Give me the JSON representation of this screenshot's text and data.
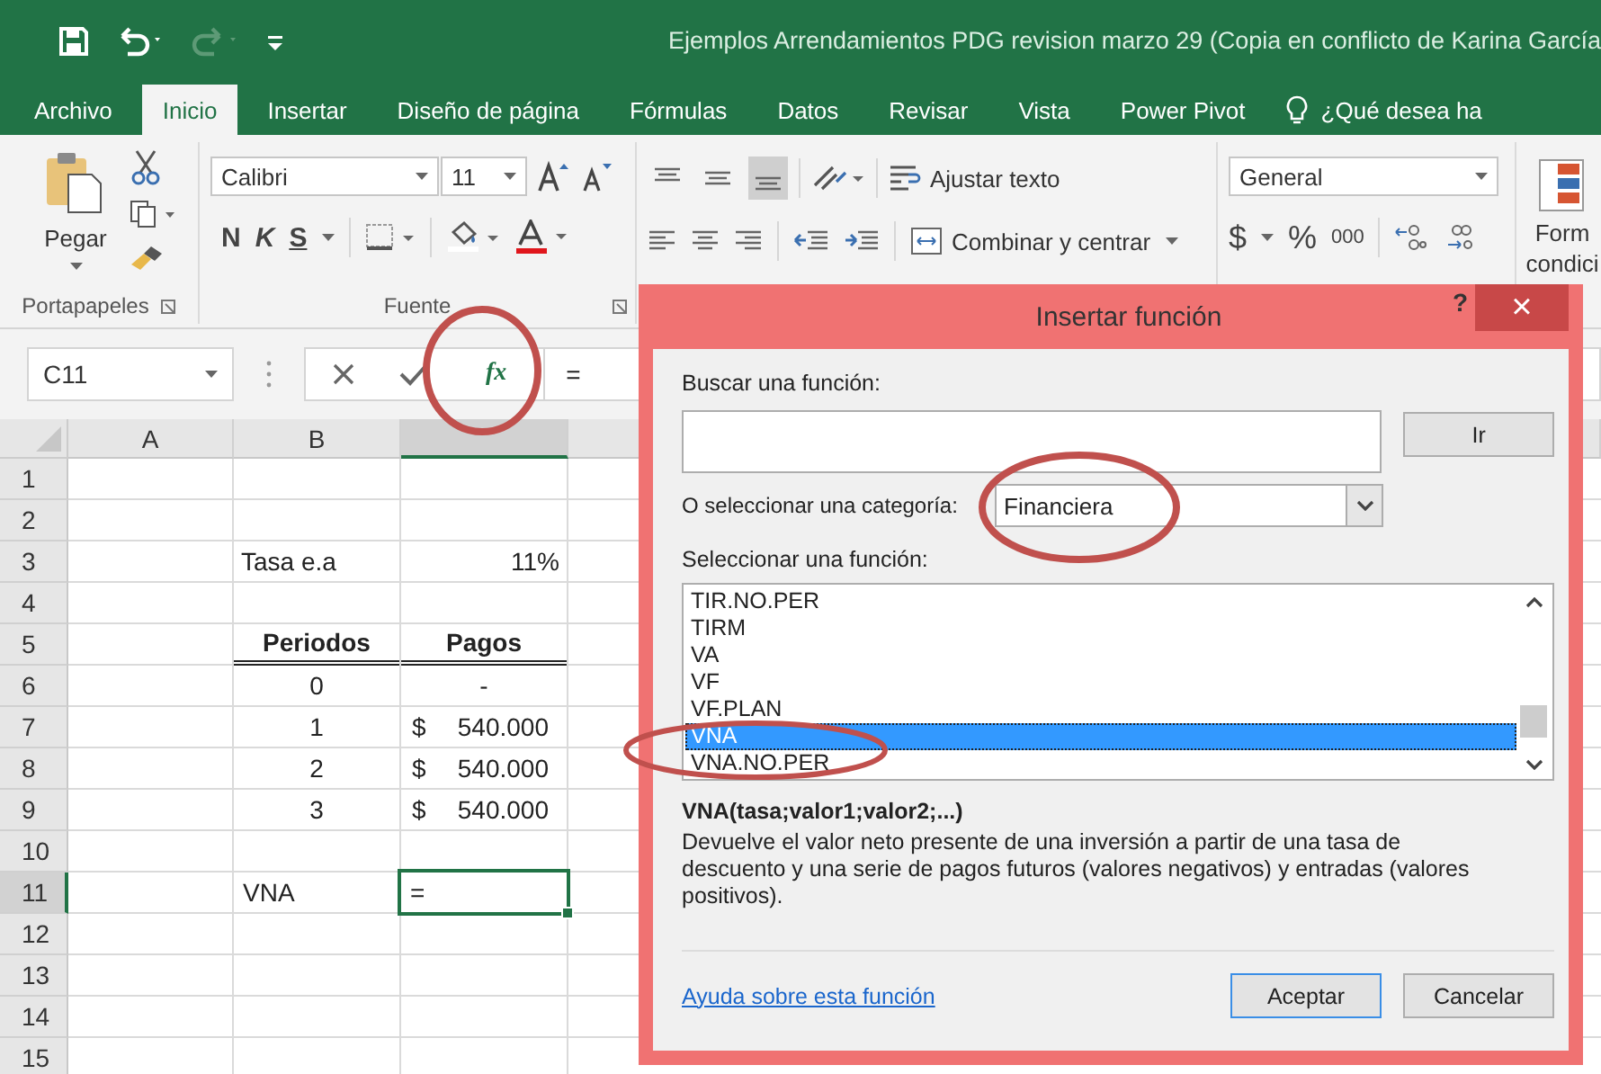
{
  "title_bar": {
    "quick_access": [
      {
        "kind": "save",
        "disabled": false
      },
      {
        "kind": "undo",
        "disabled": false
      },
      {
        "kind": "redo",
        "disabled": true
      },
      {
        "kind": "customize",
        "disabled": false
      }
    ],
    "title": "Ejemplos Arrendamientos PDG revision marzo 29 (Copia en conflicto de Karina García"
  },
  "tabs": [
    {
      "label": "Archivo",
      "selected": false
    },
    {
      "label": "Inicio",
      "selected": true
    },
    {
      "label": "Insertar",
      "selected": false
    },
    {
      "label": "Diseño de página",
      "selected": false
    },
    {
      "label": "Fórmulas",
      "selected": false
    },
    {
      "label": "Datos",
      "selected": false
    },
    {
      "label": "Revisar",
      "selected": false
    },
    {
      "label": "Vista",
      "selected": false
    },
    {
      "label": "Power Pivot",
      "selected": false
    }
  ],
  "tell_me": {
    "label": "¿Qué desea ha"
  },
  "ribbon": {
    "clipboard": {
      "paste": "Pegar",
      "label": "Portapapeles"
    },
    "font": {
      "name": "Calibri",
      "size": "11",
      "bold": "N",
      "italic": "K",
      "underline": "S",
      "label": "Fuente"
    },
    "alignment": {
      "vertical_align": [
        {
          "selected": false
        },
        {
          "selected": false
        },
        {
          "selected": true
        }
      ],
      "wrap": "Ajustar texto",
      "merge": "Combinar y centrar"
    },
    "number": {
      "format": "General",
      "currency": "$",
      "percent": "%",
      "thousands": "000"
    },
    "styles": {
      "conditional": [
        "Form",
        "condici"
      ]
    }
  },
  "formula_bar": {
    "name_box": "C11",
    "function_button": "fx",
    "formula": "="
  },
  "sheet": {
    "columns": [
      {
        "label": "A",
        "selected": false
      },
      {
        "label": "B",
        "selected": false
      },
      {
        "selected": true
      }
    ],
    "rows": [
      {
        "number": "1",
        "selected": false,
        "kind": "label"
      },
      {
        "number": "2",
        "selected": false,
        "kind": "label"
      },
      {
        "number": "3",
        "selected": false,
        "kind": "label",
        "b": "Tasa e.a",
        "c": "11%"
      },
      {
        "number": "4",
        "selected": false,
        "kind": "label"
      },
      {
        "number": "5",
        "selected": false,
        "kind": "header",
        "b": "Periodos",
        "c": "Pagos"
      },
      {
        "number": "6",
        "selected": false,
        "kind": "data",
        "b": "0",
        "c": "-"
      },
      {
        "number": "7",
        "selected": false,
        "kind": "data",
        "b": "1",
        "currency": "$",
        "c": "540.000"
      },
      {
        "number": "8",
        "selected": false,
        "kind": "data",
        "b": "2",
        "currency": "$",
        "c": "540.000"
      },
      {
        "number": "9",
        "selected": false,
        "kind": "data",
        "b": "3",
        "currency": "$",
        "c": "540.000"
      },
      {
        "number": "10",
        "selected": false,
        "kind": "label"
      },
      {
        "number": "11",
        "selected": true,
        "kind": "input",
        "b": "VNA",
        "entry": "="
      },
      {
        "number": "12",
        "selected": false,
        "kind": "label"
      },
      {
        "number": "13",
        "selected": false,
        "kind": "label"
      },
      {
        "number": "14",
        "selected": false,
        "kind": "label"
      },
      {
        "number": "15",
        "selected": false,
        "kind": "label"
      }
    ]
  },
  "dialog": {
    "title": "Insertar función",
    "help": "?",
    "close": "×",
    "search_label": "Buscar una función:",
    "go_button": "Ir",
    "category_label": "O seleccionar una categoría:",
    "category": "Financiera",
    "function_label": "Seleccionar una función:",
    "functions": [
      {
        "name": "TIR.NO.PER",
        "selected": false
      },
      {
        "name": "TIRM",
        "selected": false
      },
      {
        "name": "VA",
        "selected": false
      },
      {
        "name": "VF",
        "selected": false
      },
      {
        "name": "VF.PLAN",
        "selected": false
      },
      {
        "name": "VNA",
        "selected": true
      },
      {
        "name": "VNA.NO.PER",
        "selected": false
      }
    ],
    "signature": "VNA(tasa;valor1;valor2;...)",
    "description": "Devuelve el valor neto presente de una inversión a partir de una tasa de descuento y una serie de pagos futuros (valores negativos) y entradas (valores positivos).",
    "help_link": "Ayuda sobre esta función",
    "buttons": [
      "Aceptar",
      "Cancelar"
    ]
  }
}
